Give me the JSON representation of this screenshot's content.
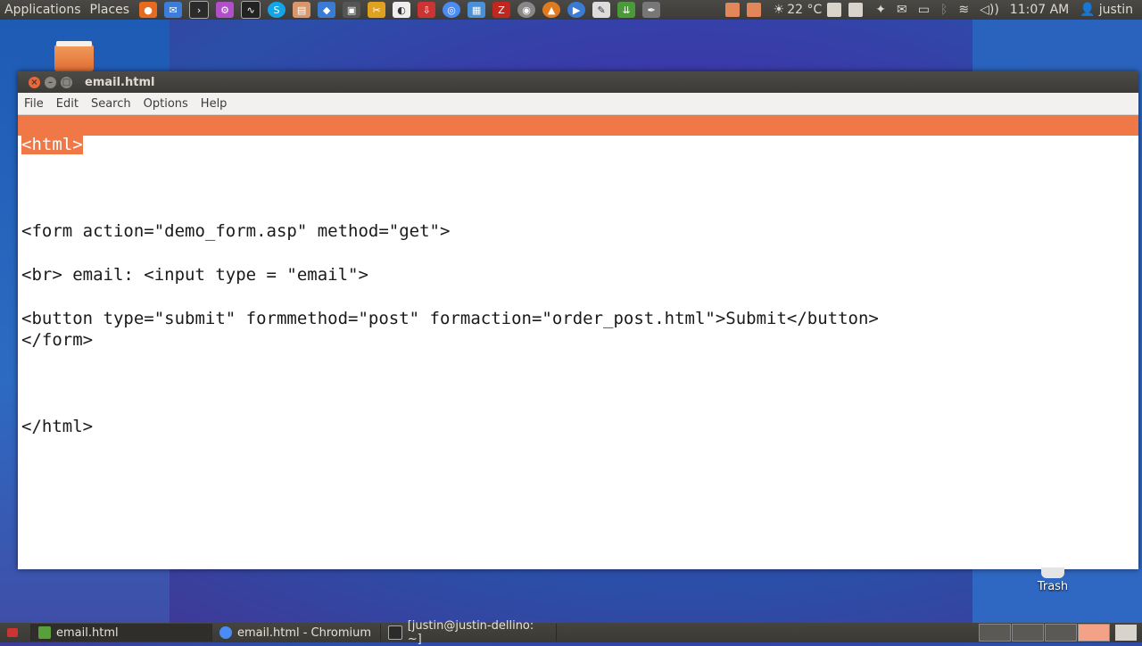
{
  "top_panel": {
    "menus": [
      "Applications",
      "Places"
    ],
    "weather": "22 °C",
    "clock": "11:07 AM",
    "user": "justin"
  },
  "window": {
    "title": "email.html",
    "menu": [
      "File",
      "Edit",
      "Search",
      "Options",
      "Help"
    ]
  },
  "editor": {
    "lines": [
      "<html>",
      "<form action=\"demo_form.asp\" method=\"get\">",
      "<br> email: <input type = \"email\">",
      "<button type=\"submit\" formmethod=\"post\" formaction=\"order_post.html\">Submit</button>",
      "</form>",
      "</html>"
    ]
  },
  "desktop": {
    "trash_label": "Trash"
  },
  "taskbar": {
    "tasks": [
      "email.html",
      "email.html - Chromium",
      "[justin@justin-dellino: ~]"
    ]
  },
  "colors": {
    "accent": "#f07746",
    "panel": "#3c3b37"
  }
}
